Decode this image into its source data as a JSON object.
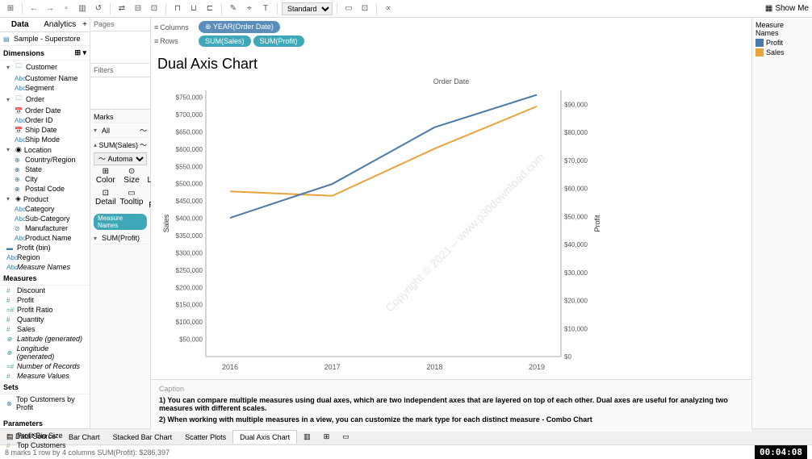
{
  "toolbar": {
    "mode": "Standard",
    "showme": "Show Me"
  },
  "left": {
    "tabs": [
      "Data",
      "Analytics"
    ],
    "source": "Sample - Superstore",
    "dim_header": "Dimensions",
    "dims": {
      "customer": {
        "label": "Customer",
        "items": [
          "Customer Name",
          "Segment"
        ]
      },
      "order": {
        "label": "Order",
        "items": [
          "Order Date",
          "Order ID",
          "Ship Date",
          "Ship Mode"
        ]
      },
      "location": {
        "label": "Location",
        "items": [
          "Country/Region",
          "State",
          "City",
          "Postal Code"
        ]
      },
      "product": {
        "label": "Product",
        "items": [
          "Category",
          "Sub-Category",
          "Manufacturer",
          "Product Name"
        ]
      },
      "other": [
        "Profit (bin)",
        "Region",
        "Measure Names"
      ]
    },
    "meas_header": "Measures",
    "measures": [
      "Discount",
      "Profit",
      "Profit Ratio",
      "Quantity",
      "Sales",
      "Latitude (generated)",
      "Longitude (generated)",
      "Number of Records",
      "Measure Values"
    ],
    "sets_header": "Sets",
    "sets": [
      "Top Customers by Profit"
    ],
    "params_header": "Parameters",
    "params": [
      "Profit Bin Size",
      "Top Customers"
    ]
  },
  "pages": {
    "pages": "Pages",
    "filters": "Filters"
  },
  "marks": {
    "header": "Marks",
    "all": "All",
    "sum_sales": "SUM(Sales)",
    "sum_profit": "SUM(Profit)",
    "type": "Automatic",
    "cells": [
      "Color",
      "Size",
      "Label",
      "Detail",
      "Tooltip",
      "Path"
    ],
    "pill": "Measure Names"
  },
  "shelves": {
    "columns": "Columns",
    "rows": "Rows",
    "col_pill": "YEAR(Order Date)",
    "row_pill1": "SUM(Sales)",
    "row_pill2": "SUM(Profit)"
  },
  "chart_data": {
    "type": "line",
    "title": "Dual Axis Chart",
    "subtitle": "Order Date",
    "ylabel_left": "Sales",
    "ylabel_right": "Profit",
    "categories": [
      "2016",
      "2017",
      "2018",
      "2019"
    ],
    "series": [
      {
        "name": "Sales",
        "axis": "left",
        "color": "#e8a33d",
        "values": [
          484000,
          471000,
          609000,
          733000
        ]
      },
      {
        "name": "Profit",
        "axis": "right",
        "color": "#4a7ba6",
        "values": [
          49500,
          61600,
          81800,
          93400
        ]
      }
    ],
    "y_left_ticks": [
      "$50,000",
      "$100,000",
      "$150,000",
      "$200,000",
      "$250,000",
      "$300,000",
      "$350,000",
      "$400,000",
      "$450,000",
      "$500,000",
      "$550,000",
      "$600,000",
      "$650,000",
      "$700,000",
      "$750,000"
    ],
    "y_left_lim": [
      0,
      780000
    ],
    "y_right_ticks": [
      "$0",
      "$10,000",
      "$20,000",
      "$30,000",
      "$40,000",
      "$50,000",
      "$60,000",
      "$70,000",
      "$80,000",
      "$90,000"
    ],
    "y_right_lim": [
      0,
      95000
    ]
  },
  "legend": {
    "header": "Measure Names",
    "items": [
      {
        "label": "Profit",
        "color": "#4a7ba6"
      },
      {
        "label": "Sales",
        "color": "#e8a33d"
      }
    ]
  },
  "caption": {
    "label": "Caption",
    "line1": "1) You can compare multiple measures using dual axes, which are two independent axes that are layered on top of each other. Dual axes are useful for analyzing two measures with different scales.",
    "line2": "2) When working with multiple measures in a view, you can customize the mark type for each distinct measure - Combo Chart"
  },
  "tabs": {
    "ds": "Data Source",
    "items": [
      "Bar Chart",
      "Stacked Bar Chart",
      "Scatter Plots",
      "Dual Axis Chart"
    ]
  },
  "status": {
    "text": "8 marks   1 row by 4 columns   SUM(Profit): $286,397",
    "timer": "00:04:08"
  },
  "watermark": "Copyright © 2021 – www.p30download.com"
}
